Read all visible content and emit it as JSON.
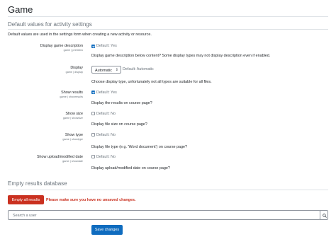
{
  "page": {
    "title": "Game"
  },
  "defaults_section": {
    "heading": "Default values for activity settings",
    "description": "Default values are used in the settings form when creating a new activity or resource."
  },
  "settings": {
    "printintro": {
      "label": "Display game description",
      "key": "game | printintro",
      "checked": true,
      "default_text": "Default: Yes",
      "help": "Display game description below content? Some display types may not display description even if enabled."
    },
    "display": {
      "label": "Display",
      "key": "game | display",
      "selected": "Automatic",
      "default_text": "Default: Automatic",
      "help": "Choose display type, unfortunately not all types are suitable for all files."
    },
    "showresults": {
      "label": "Show results",
      "key": "game | showresults",
      "checked": true,
      "default_text": "Default: Yes",
      "help": "Display the results on course page?"
    },
    "showsize": {
      "label": "Show size",
      "key": "game | showsize",
      "checked": false,
      "default_text": "Default: No",
      "help": "Display file size on course page?"
    },
    "showtype": {
      "label": "Show type",
      "key": "game | showtype",
      "checked": false,
      "default_text": "Default: No",
      "help": "Display file type (e.g. 'Word document') on course page?"
    },
    "showdate": {
      "label": "Show upload/modified date",
      "key": "game | showdate",
      "checked": false,
      "default_text": "Default: No",
      "help": "Display upload/modified date on course page?"
    }
  },
  "results_section": {
    "heading": "Empty results database",
    "button_label": "Empty all results",
    "warning": "Please make sure you have no unsaved changes."
  },
  "search": {
    "placeholder": "Search a user"
  },
  "form": {
    "save_label": "Save changes"
  },
  "colors": {
    "primary": "#0f6cbf",
    "danger": "#ca3120",
    "muted": "#6a737b"
  }
}
